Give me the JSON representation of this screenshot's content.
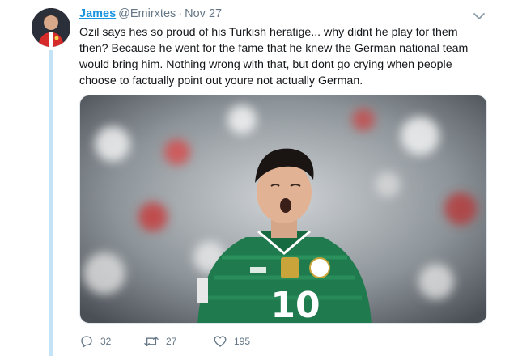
{
  "tweet": {
    "author": {
      "display_name": "James",
      "handle": "@Emirxtes",
      "avatar_icon": "avatar-icon"
    },
    "separator": "·",
    "date": "Nov 27",
    "text": "Ozil says hes so proud of his Turkish heratige... why didnt he play for them then? Because he went for the fame that he knew the German national team would bring him. Nothing wrong with that, but dont go crying when people choose to factually point out youre not actually German.",
    "media": {
      "kind": "photo",
      "jersey_number": "10",
      "colors": {
        "jersey_green": "#1f7a4d",
        "background": "#9aa0a6"
      }
    },
    "actions": {
      "replies": "32",
      "retweets": "27",
      "likes": "195"
    }
  },
  "theme": {
    "link_blue": "#1b95e0",
    "muted_gray": "#657786",
    "thread_line": "#c4e3f6"
  },
  "icons": [
    "chevron-down-icon",
    "reply-icon",
    "retweet-icon",
    "like-icon"
  ]
}
